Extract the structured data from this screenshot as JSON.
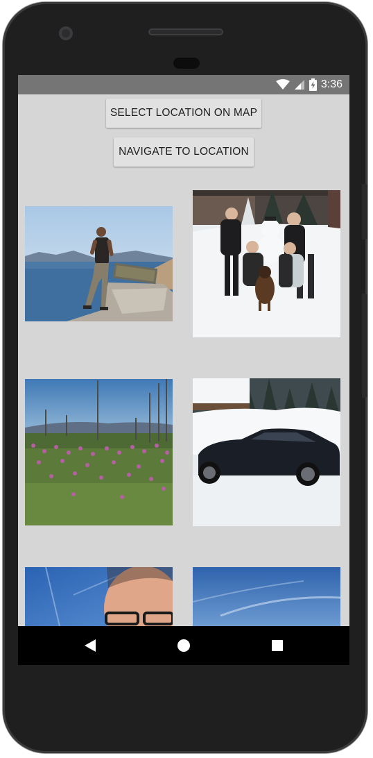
{
  "status_bar": {
    "time": "3:36",
    "icons": [
      "wifi-icon",
      "signal-icon",
      "battery-charging-icon"
    ]
  },
  "actions": {
    "select_location_label": "SELECT LOCATION ON MAP",
    "navigate_label": "NAVIGATE TO LOCATION"
  },
  "photos": [
    {
      "subject": "man standing at lake overlook"
    },
    {
      "subject": "group with dog by snowman"
    },
    {
      "subject": "purple wildflower meadow"
    },
    {
      "subject": "dark sedan in snow"
    },
    {
      "subject": "selfie with glasses under blue sky"
    },
    {
      "subject": "blue sky with clouds"
    }
  ],
  "nav_bar": {
    "icons": [
      "back-icon",
      "home-icon",
      "recents-icon"
    ]
  },
  "colors": {
    "screen_background": "#d6d6d6",
    "status_bar": "#757575",
    "button_background": "#e1e1e1",
    "nav_bar": "#000000"
  }
}
